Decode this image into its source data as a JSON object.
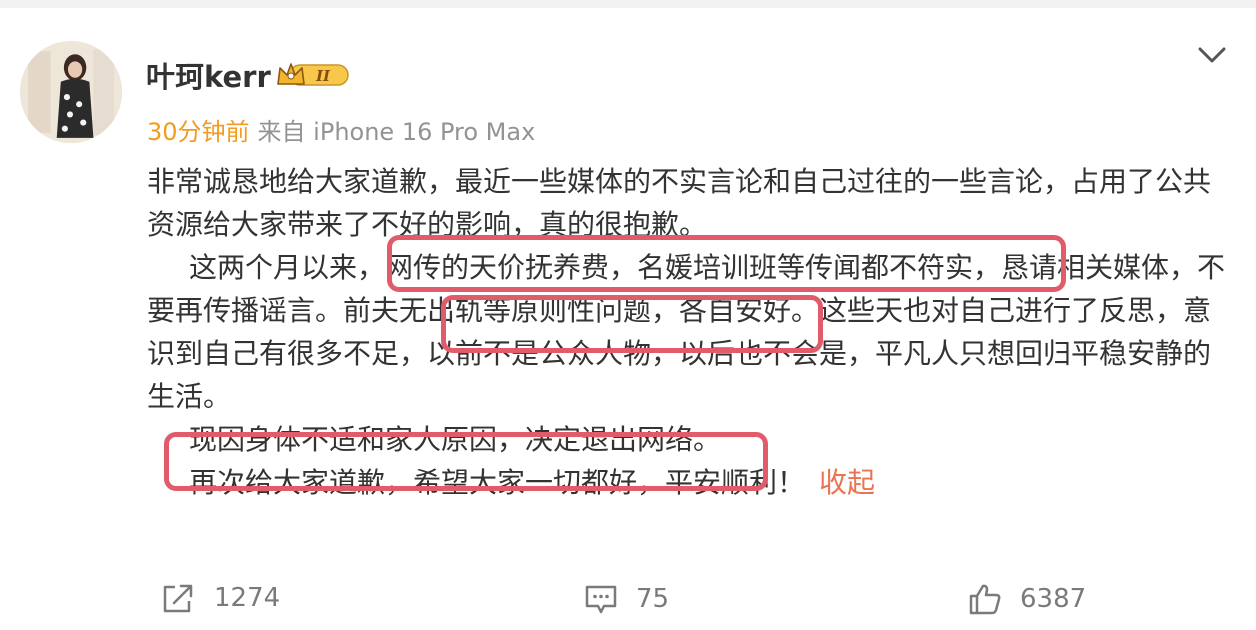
{
  "post": {
    "author": {
      "name": "叶珂kerr",
      "vip_level": "II"
    },
    "meta": {
      "time": "30分钟前",
      "source": "来自 iPhone 16 Pro Max"
    },
    "paragraphs": {
      "p1": "非常诚恳地给大家道歉，最近一些媒体的不实言论和自己过往的一些言论，占用了公共资源给大家带来了不好的影响，真的很抱歉。",
      "p2a": "这两个月以来，",
      "p2b": "网传的天价抚养费，名媛培训班等传闻都不符实，",
      "p2c": "恳请相关媒体，不要再传播谣言。",
      "p2d": "前夫无出轨等原则性问题，",
      "p2e": "各自安好。这些天也对自己进行了反思，意识到自己有很多不足，以前不是公众人物，以后也不会是，平凡人只想回归平稳安静的生活。",
      "p3": "现因身体不适和家人原因，决定退出网络。",
      "p4": "再次给大家道歉，希望大家一切都好，平安顺利！"
    },
    "collapse_label": "收起",
    "actions": {
      "share_count": "1274",
      "comment_count": "75",
      "like_count": "6387"
    },
    "highlight_color": "#e15c6b",
    "accent_color": "#f29b1f",
    "icons": [
      "avatar",
      "vip-crown-icon",
      "chevron-down-icon",
      "share-icon",
      "comment-icon",
      "like-icon"
    ]
  }
}
